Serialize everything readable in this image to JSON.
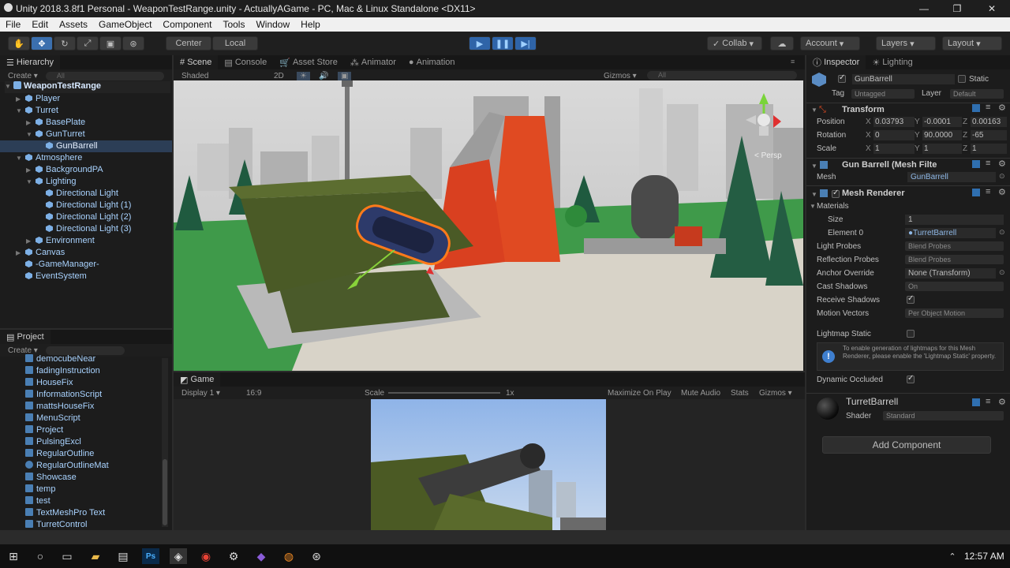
{
  "window": {
    "title": "Unity 2018.3.8f1 Personal - WeaponTestRange.unity - ActuallyAGame - PC, Mac & Linux Standalone <DX11>"
  },
  "menu": [
    "File",
    "Edit",
    "Assets",
    "GameObject",
    "Component",
    "Tools",
    "Window",
    "Help"
  ],
  "toolbar": {
    "center": "Center",
    "local": "Local",
    "collab": "Collab",
    "account": "Account",
    "layers": "Layers",
    "layout": "Layout"
  },
  "hierarchy": {
    "tab": "Hierarchy",
    "create": "Create",
    "search": "All",
    "root": "WeaponTestRange",
    "items": [
      "Player",
      "Turret",
      "BasePlate",
      "GunTurret",
      "GunBarrell",
      "Atmosphere",
      "BackgroundPA",
      "Lighting",
      "Directional Light",
      "Directional Light (1)",
      "Directional Light (2)",
      "Directional Light (3)",
      "Environment",
      "Canvas",
      "-GameManager-",
      "EventSystem"
    ]
  },
  "project": {
    "tab": "Project",
    "create": "Create",
    "items": [
      "democubeNear",
      "fadingInstruction",
      "HouseFix",
      "InformationScript",
      "mattsHouseFix",
      "MenuScript",
      "Project",
      "PulsingExcl",
      "RegularOutline",
      "RegularOutlineMat",
      "Showcase",
      "temp",
      "test",
      "TextMeshPro Text",
      "TurretControl"
    ]
  },
  "scene": {
    "tabs": [
      "Scene",
      "Console",
      "Asset Store",
      "Animator",
      "Animation"
    ],
    "shading": "Shaded",
    "mode2d": "2D",
    "gizmos": "Gizmos",
    "search": "All",
    "persp": "< Persp"
  },
  "game": {
    "tab": "Game",
    "display": "Display 1",
    "aspect": "16:9",
    "scale_label": "Scale",
    "scale_value": "1x",
    "maximize": "Maximize On Play",
    "mute": "Mute Audio",
    "stats": "Stats",
    "gizmos": "Gizmos"
  },
  "inspector": {
    "tabs": [
      "Inspector",
      "Lighting"
    ],
    "object_name": "GunBarrell",
    "static": "Static",
    "tag_label": "Tag",
    "tag": "Untagged",
    "layer_label": "Layer",
    "layer": "Default",
    "transform": {
      "title": "Transform",
      "position": {
        "label": "Position",
        "x": "0.03793",
        "y": "-0.0001",
        "z": "0.00163"
      },
      "rotation": {
        "label": "Rotation",
        "x": "0",
        "y": "90.0000",
        "z": "-65"
      },
      "scale": {
        "label": "Scale",
        "x": "1",
        "y": "1",
        "z": "1"
      }
    },
    "mesh_filter": {
      "title": "Gun Barrell (Mesh Filte",
      "mesh_label": "Mesh",
      "mesh": "GunBarrell"
    },
    "mesh_renderer": {
      "title": "Mesh Renderer",
      "materials": "Materials",
      "size_label": "Size",
      "size": "1",
      "element0_label": "Element 0",
      "element0": "TurretBarrell",
      "light_probes_label": "Light Probes",
      "light_probes": "Blend Probes",
      "reflection_probes_label": "Reflection Probes",
      "reflection_probes": "Blend Probes",
      "anchor_label": "Anchor Override",
      "anchor": "None (Transform)",
      "cast_shadows_label": "Cast Shadows",
      "cast_shadows": "On",
      "receive_shadows_label": "Receive Shadows",
      "motion_vectors_label": "Motion Vectors",
      "motion_vectors": "Per Object Motion",
      "lightmap_static_label": "Lightmap Static",
      "info": "To enable generation of lightmaps for this Mesh Renderer, please enable the 'Lightmap Static' property.",
      "dynamic_occluded_label": "Dynamic Occluded"
    },
    "material": {
      "name": "TurretBarrell",
      "shader_label": "Shader",
      "shader": "Standard"
    },
    "add_component": "Add Component"
  },
  "taskbar": {
    "time": "12:57 AM"
  },
  "colors": {
    "accent": "#3b6fae",
    "hierarchy_text": "#a9d3ff",
    "selection_outline": "#ff7a1a"
  }
}
